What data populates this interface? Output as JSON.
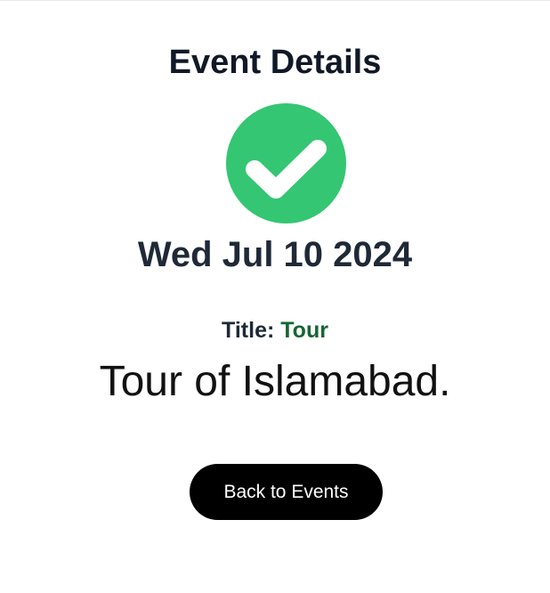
{
  "page": {
    "heading": "Event Details",
    "status_icon": "check-circle-icon",
    "date": "Wed Jul 10 2024",
    "title_label": "Title:",
    "title_value": "Tour",
    "description": "Tour of Islamabad.",
    "back_button_label": "Back to Events"
  },
  "colors": {
    "success_green": "#34c672",
    "title_value_green": "#166534",
    "button_black": "#000000"
  }
}
